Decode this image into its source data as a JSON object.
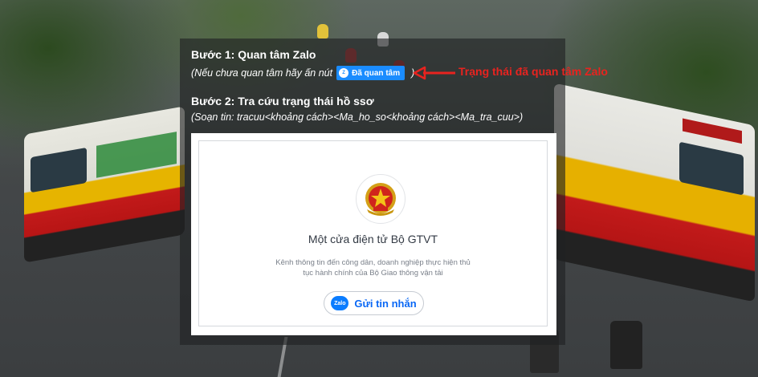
{
  "instructions": {
    "step1": {
      "title": "Bước 1: Quan tâm Zalo",
      "note_prefix": "(Nếu chưa quan tâm hãy ấn nút",
      "follow_button_label": "Đã quan tâm",
      "note_suffix": ")"
    },
    "annotation": "Trạng thái đã quan tâm Zalo",
    "step2": {
      "title": "Bước 2: Tra cứu trạng thái hồ ssơ",
      "note": "(Soạn tin: tracuu<khoảng cách><Ma_ho_so<khoảng cách><Ma_tra_cuu>)"
    }
  },
  "card": {
    "title": "Một cửa điện tử Bộ GTVT",
    "description": "Kênh thông tin đến công dân, doanh nghiệp thực hiện thủ tục hành chính của Bộ Giao thông vận tải",
    "send_button_label": "Gửi tin nhắn",
    "zalo_logo_text": "Zalo",
    "emblem_icon": "national-emblem-icon"
  },
  "colors": {
    "annotation": "#e8231f",
    "follow_button": "#1a8cff",
    "zalo_blue": "#0a68f5"
  }
}
